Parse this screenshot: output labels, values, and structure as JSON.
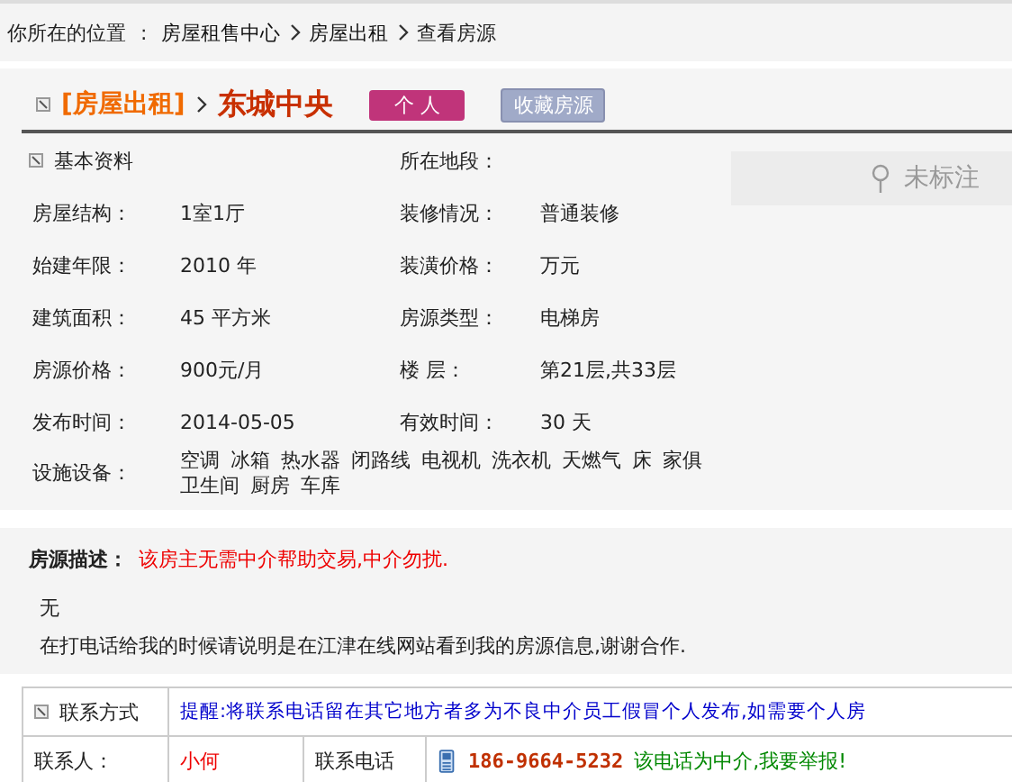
{
  "breadcrumb": {
    "label": "你所在的位置",
    "separator": ":",
    "items": [
      "房屋租售中心",
      "房屋出租",
      "查看房源"
    ]
  },
  "title": {
    "category": "[房屋出租]",
    "name": "东城中央",
    "badge": "个 人",
    "favorite_button": "收藏房源"
  },
  "basic": {
    "heading": "基本资料",
    "location_label": "所在地段：",
    "map_text": "未标注",
    "rows": [
      {
        "label": "房屋结构：",
        "value": "1室1厅",
        "label2": "装修情况：",
        "value2": "普通装修"
      },
      {
        "label": "始建年限：",
        "value": "2010 年",
        "label2": "装潢价格：",
        "value2": " 万元"
      },
      {
        "label": "建筑面积：",
        "value": "45 平方米",
        "label2": "房源类型：",
        "value2": "电梯房"
      },
      {
        "label": "房源价格：",
        "value": "900元/月",
        "label2": "楼 层：",
        "value2": "第21层,共33层"
      },
      {
        "label": "发布时间：",
        "value": "2014-05-05",
        "label2": "有效时间：",
        "value2": "30 天"
      }
    ],
    "facilities_label": "设施设备：",
    "facilities": [
      "空调",
      "冰箱",
      "热水器",
      "闭路线",
      "电视机",
      "洗衣机",
      "天燃气",
      "床",
      "家俱",
      "卫生间",
      "厨房",
      "车库"
    ]
  },
  "description": {
    "label": "房源描述：",
    "notice": "该房主无需中介帮助交易,中介勿扰.",
    "text": "无",
    "note": "在打电话给我的时候请说明是在江津在线网站看到我的房源信息,谢谢合作."
  },
  "contact": {
    "heading": "联系方式",
    "reminder": "提醒:将联系电话留在其它地方者多为不良中介员工假冒个人发布,如需要个人房",
    "person_label": "联系人：",
    "person": "小何",
    "phone_label": "联系电话",
    "phone": "186-9664-5232",
    "report_link": "该电话为中介,我要举报!"
  }
}
